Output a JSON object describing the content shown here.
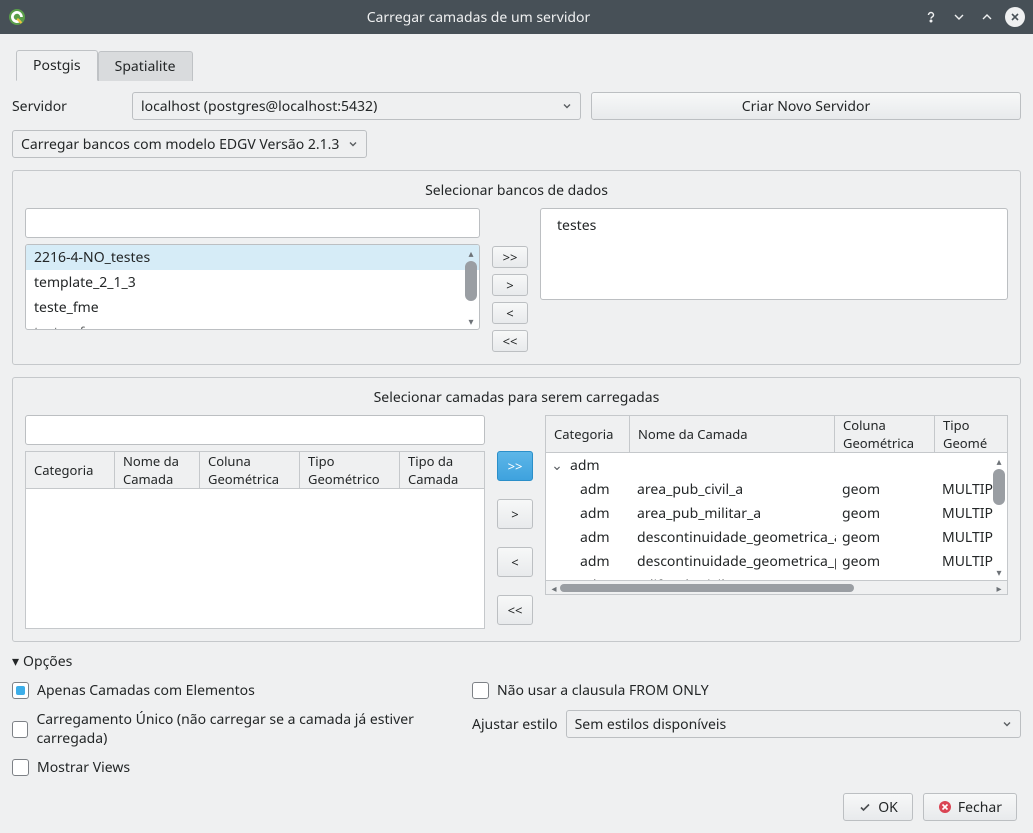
{
  "window": {
    "title": "Carregar camadas de um servidor"
  },
  "tabs": {
    "postgis": "Postgis",
    "spatialite": "Spatialite"
  },
  "server": {
    "label": "Servidor",
    "value": "localhost (postgres@localhost:5432)",
    "new_btn": "Criar Novo Servidor"
  },
  "model_select": "Carregar bancos com modelo EDGV Versão 2.1.3",
  "db_group": {
    "title": "Selecionar bancos de dados",
    "left_filter": "",
    "left_items": [
      "2216-4-NO_testes",
      "template_2_1_3",
      "teste_fme",
      "testes_fme"
    ],
    "left_selected": 0,
    "right_items": [
      "testes"
    ],
    "move": {
      "all_right": ">>",
      "one_right": ">",
      "one_left": "<",
      "all_left": "<<"
    }
  },
  "layers_group": {
    "title": "Selecionar camadas para serem carregadas",
    "left_filter": "",
    "headers": {
      "cat": "Categoria",
      "nome": "Nome da Camada",
      "col": "Coluna Geométrica",
      "tipo_g": "Tipo Geométrico",
      "tipo_c": "Tipo da Camada",
      "tipo_g_short": "Tipo Geomé"
    },
    "tree_root": "adm",
    "rows": [
      {
        "cat": "adm",
        "nome": "area_pub_civil_a",
        "col": "geom",
        "tipo": "MULTIP"
      },
      {
        "cat": "adm",
        "nome": "area_pub_militar_a",
        "col": "geom",
        "tipo": "MULTIP"
      },
      {
        "cat": "adm",
        "nome": "descontinuidade_geometrica_a",
        "col": "geom",
        "tipo": "MULTIP"
      },
      {
        "cat": "adm",
        "nome": "descontinuidade_geometrica_p",
        "col": "geom",
        "tipo": "MULTIP"
      },
      {
        "cat": "adm",
        "nome": "edif_pub_civil_a",
        "col": "geom",
        "tipo": "MULTIP"
      }
    ],
    "move": {
      "all_right": ">>",
      "one_right": ">",
      "one_left": "<",
      "all_left": "<<"
    }
  },
  "options": {
    "header": "Opções",
    "only_with_elements": "Apenas Camadas com Elementos",
    "no_from_only": "Não usar a clausula FROM ONLY",
    "unique_load": "Carregamento Único (não carregar se a camada já estiver carregada)",
    "style_label": "Ajustar estilo",
    "style_value": "Sem estilos disponíveis",
    "show_views": "Mostrar Views"
  },
  "footer": {
    "ok": "OK",
    "close": "Fechar"
  }
}
